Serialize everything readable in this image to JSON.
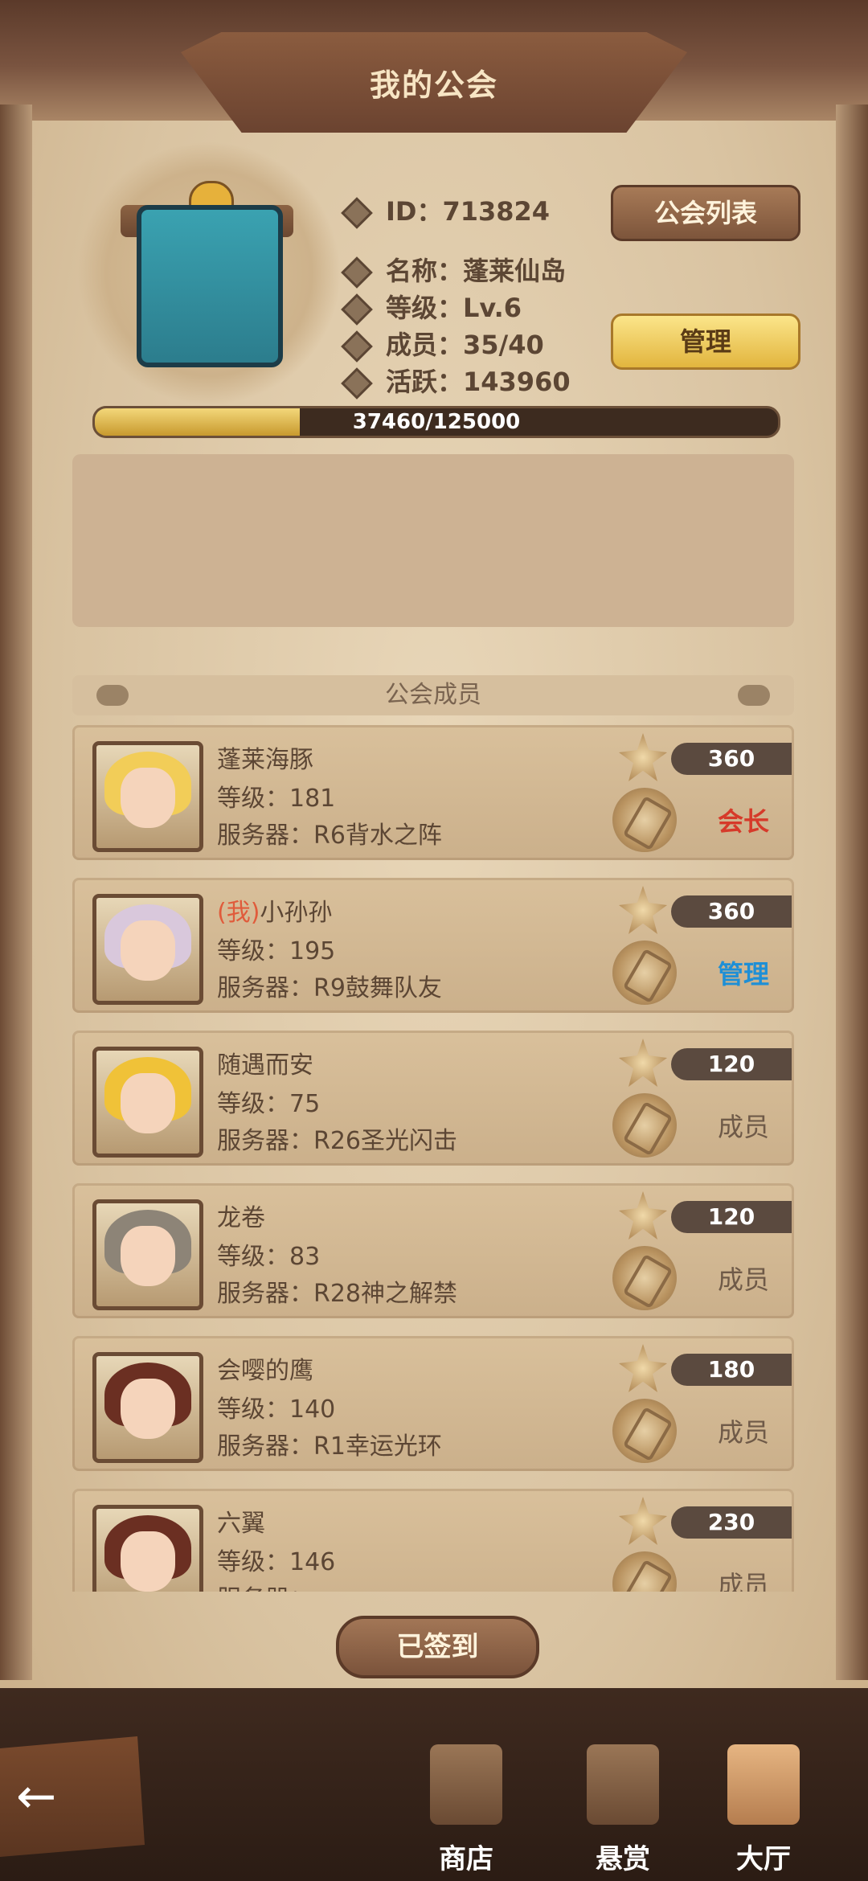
{
  "title": "我的公会",
  "guild": {
    "id_label": "ID：713824",
    "name_label": "名称：蓬莱仙岛",
    "level_label": "等级：Lv.6",
    "members_label": "成员：35/40",
    "activity_label": "活跃：143960",
    "list_button": "公会列表",
    "manage_button": "管理",
    "exp_text": "37460/125000",
    "exp_fraction": 0.2997,
    "notice": ""
  },
  "members_header": "公会成员",
  "members": [
    {
      "name": "蓬莱海豚",
      "me": "",
      "level": "等级：181",
      "server": "服务器：R6背水之阵",
      "points": "360",
      "role": "会长",
      "role_type": "leader",
      "hair": "#f2cd58"
    },
    {
      "name": "小孙孙",
      "me": "(我)",
      "level": "等级：195",
      "server": "服务器：R9鼓舞队友",
      "points": "360",
      "role": "管理",
      "role_type": "admin",
      "hair": "#d9c8dc"
    },
    {
      "name": "随遇而安",
      "me": "",
      "level": "等级：75",
      "server": "服务器：R26圣光闪击",
      "points": "120",
      "role": "成员",
      "role_type": "member",
      "hair": "#f0c238"
    },
    {
      "name": "龙卷",
      "me": "",
      "level": "等级：83",
      "server": "服务器：R28神之解禁",
      "points": "120",
      "role": "成员",
      "role_type": "member",
      "hair": "#8d8477"
    },
    {
      "name": "会嘤的鹰",
      "me": "",
      "level": "等级：140",
      "server": "服务器：R1幸运光环",
      "points": "180",
      "role": "成员",
      "role_type": "member",
      "hair": "#6b2f22"
    },
    {
      "name": "六翼",
      "me": "",
      "level": "等级：146",
      "server": "服务器：",
      "points": "230",
      "role": "成员",
      "role_type": "member",
      "hair": "#6b2f22"
    }
  ],
  "sign_button": "已签到",
  "nav": {
    "shop": "商店",
    "bounty": "悬赏",
    "hall": "大厅",
    "back_icon": "back-arrow-icon"
  },
  "colors": {
    "leader": "#d63a2a",
    "admin": "#1e8fd6",
    "member": "#6f5a48",
    "accent": "#e2b53e"
  }
}
